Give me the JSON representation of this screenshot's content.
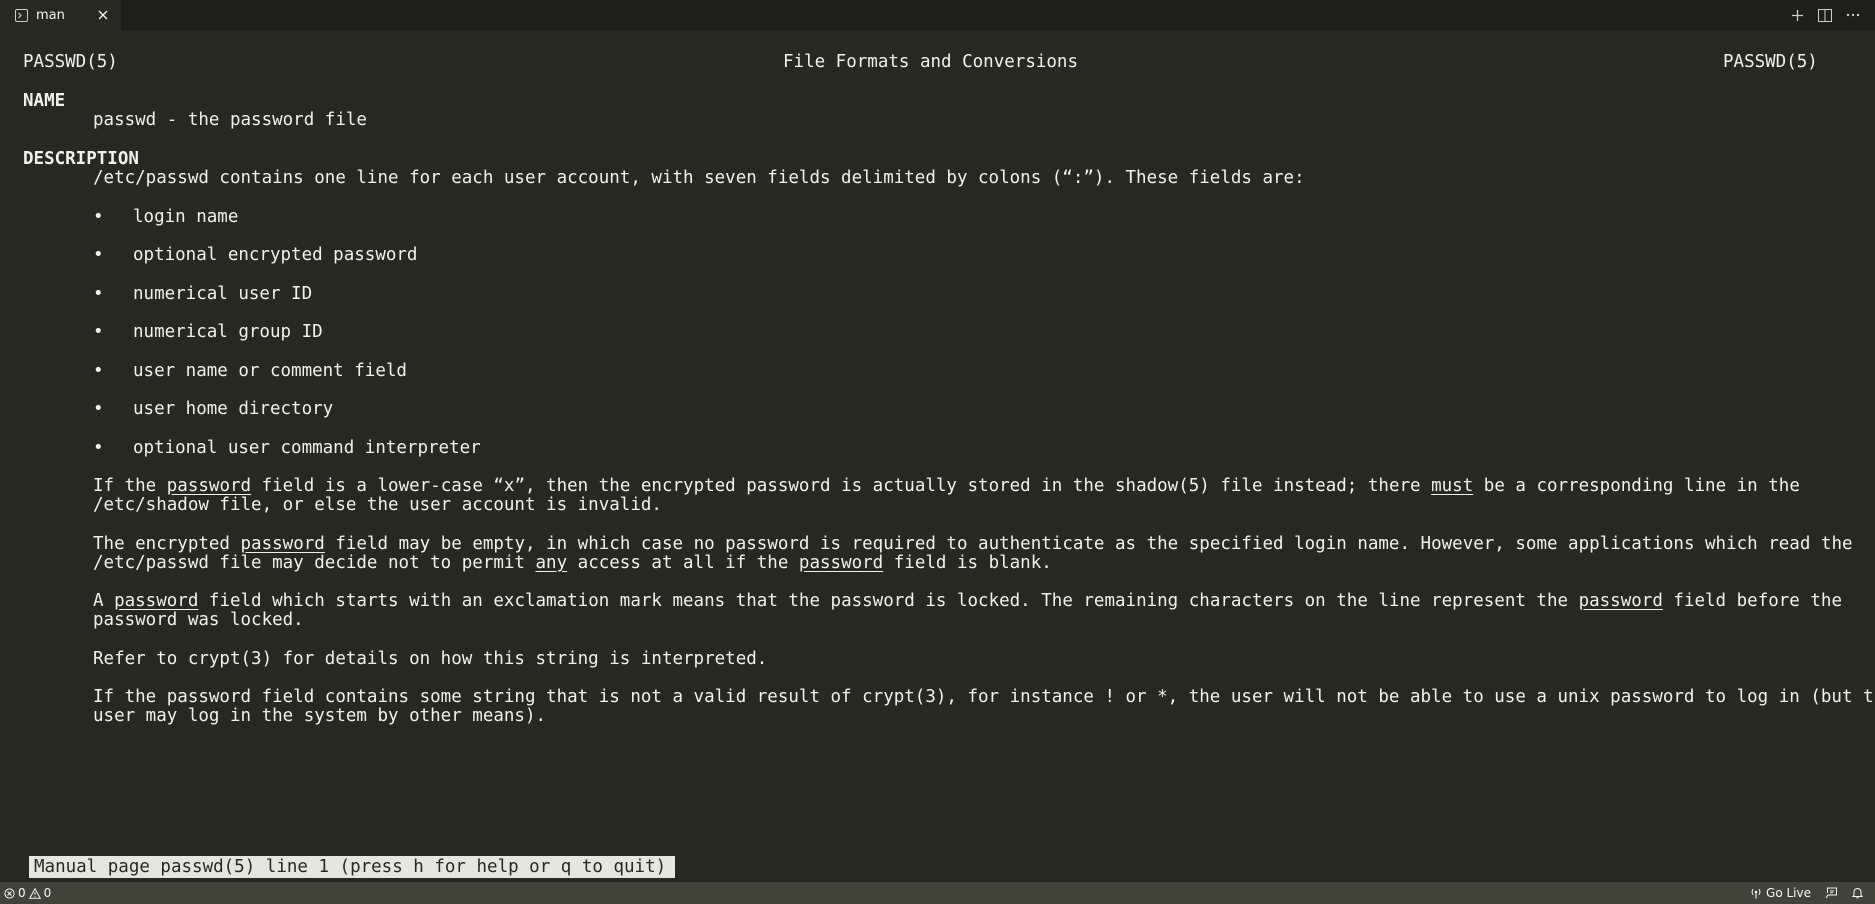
{
  "tab": {
    "label": "man"
  },
  "header": {
    "left": "PASSWD(5)",
    "center": "File Formats and Conversions",
    "right": "PASSWD(5)"
  },
  "sections": {
    "name_heading": "NAME",
    "name_text": "passwd - the password file",
    "description_heading": "DESCRIPTION",
    "intro": "/etc/passwd contains one line for each user account, with seven fields delimited by colons (“:”). These fields are:",
    "fields": [
      "login name",
      "optional encrypted password",
      "numerical user ID",
      "numerical group ID",
      "user name or comment field",
      "user home directory",
      "optional user command interpreter"
    ],
    "bullet": "•",
    "p1": {
      "a": "If the ",
      "u1": "password",
      "b": " field is a lower-case “x”, then the encrypted password is actually stored in the shadow(5) file instead; there ",
      "u2": "must",
      "c": " be a corresponding line in the",
      "line2": "/etc/shadow file, or else the user account is invalid."
    },
    "p2": {
      "a": "The encrypted ",
      "u1": "password",
      "b": " field may be empty, in which case no password is required to authenticate as the specified login name. However, some applications which read the",
      "c": "/etc/passwd file may decide not to permit ",
      "u2": "any",
      "d": " access at all if the ",
      "u3": "password",
      "e": " field is blank."
    },
    "p3": {
      "a": "A ",
      "u1": "password",
      "b": " field which starts with an exclamation mark means that the password is locked. The remaining characters on the line represent the ",
      "u2": "password",
      "c": " field before the",
      "line2": "password was locked."
    },
    "p4": "Refer to crypt(3) for details on how this string is interpreted.",
    "p5": {
      "line1": "If the password field contains some string that is not a valid result of crypt(3), for instance ! or *, the user will not be able to use a unix password to log in (but the",
      "line2": "user may log in the system by other means)."
    }
  },
  "pager_prompt": "Manual page passwd(5) line 1 (press h for help or q to quit)",
  "statusbar": {
    "errors": "0",
    "warnings": "0",
    "go_live": "Go Live"
  }
}
